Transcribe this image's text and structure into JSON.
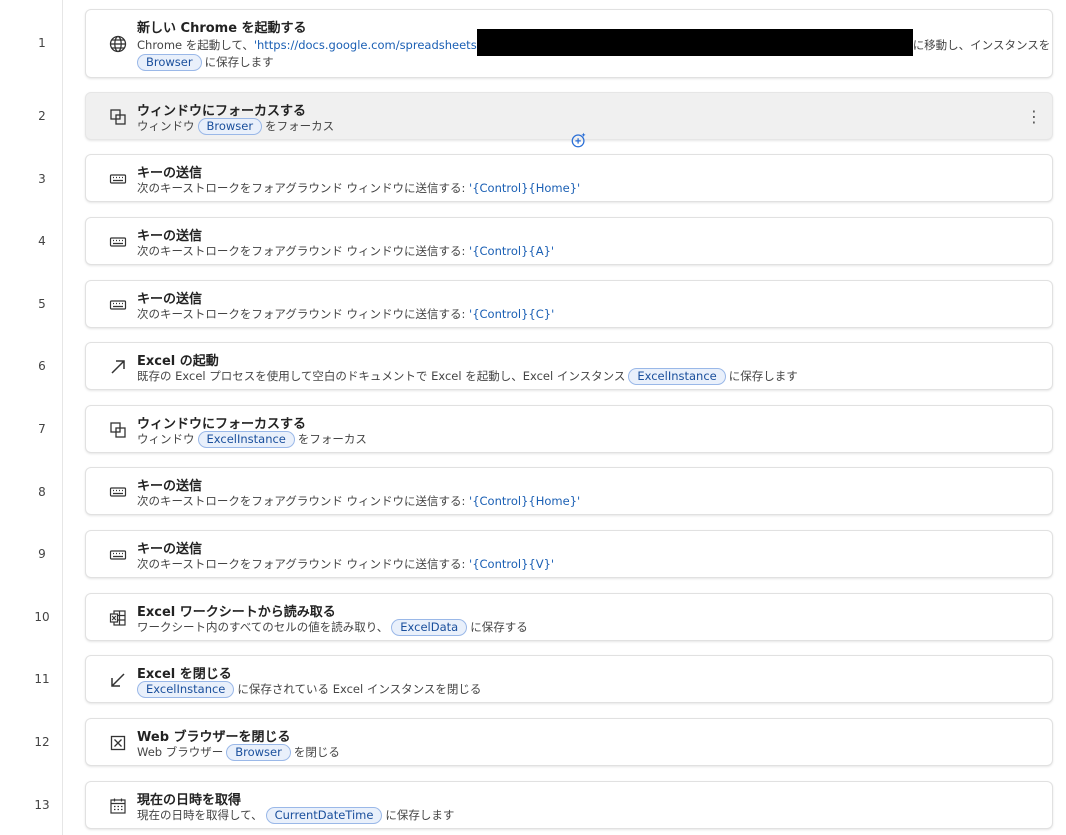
{
  "steps": [
    {
      "num": "1",
      "icon": "globe-icon",
      "title": "新しい Chrome を起動する",
      "desc_prefix": "Chrome を起動して、",
      "url": "'https://docs.google.com/spreadsheets",
      "desc_suffix": "に移動し、インスタンスを",
      "var": "Browser",
      "line2_suffix": "に保存します"
    },
    {
      "num": "2",
      "icon": "window-focus-icon",
      "title": "ウィンドウにフォーカスする",
      "desc_prefix": "ウィンドウ",
      "var": "Browser",
      "desc_suffix": "をフォーカス"
    },
    {
      "num": "3",
      "icon": "keyboard-icon",
      "title": "キーの送信",
      "desc_prefix": "次のキーストロークをフォアグラウンド ウィンドウに送信する: ",
      "value": "'{Control}{Home}'"
    },
    {
      "num": "4",
      "icon": "keyboard-icon",
      "title": "キーの送信",
      "desc_prefix": "次のキーストロークをフォアグラウンド ウィンドウに送信する: ",
      "value": "'{Control}{A}'"
    },
    {
      "num": "5",
      "icon": "keyboard-icon",
      "title": "キーの送信",
      "desc_prefix": "次のキーストロークをフォアグラウンド ウィンドウに送信する: ",
      "value": "'{Control}{C}'"
    },
    {
      "num": "6",
      "icon": "arrow-up-right-icon",
      "title": "Excel の起動",
      "desc_prefix": "既存の Excel プロセスを使用して空白のドキュメントで Excel を起動し、Excel インスタンス",
      "var": "ExcelInstance",
      "desc_suffix": "に保存します"
    },
    {
      "num": "7",
      "icon": "window-focus-icon",
      "title": "ウィンドウにフォーカスする",
      "desc_prefix": "ウィンドウ",
      "var": "ExcelInstance",
      "desc_suffix": "をフォーカス"
    },
    {
      "num": "8",
      "icon": "keyboard-icon",
      "title": "キーの送信",
      "desc_prefix": "次のキーストロークをフォアグラウンド ウィンドウに送信する: ",
      "value": "'{Control}{Home}'"
    },
    {
      "num": "9",
      "icon": "keyboard-icon",
      "title": "キーの送信",
      "desc_prefix": "次のキーストロークをフォアグラウンド ウィンドウに送信する: ",
      "value": "'{Control}{V}'"
    },
    {
      "num": "10",
      "icon": "excel-read-icon",
      "title": "Excel ワークシートから読み取る",
      "desc_prefix": "ワークシート内のすべてのセルの値を読み取り、",
      "var": "ExcelData",
      "desc_suffix": "に保存する"
    },
    {
      "num": "11",
      "icon": "arrow-down-left-icon",
      "title": "Excel を閉じる",
      "var": "ExcelInstance",
      "desc_suffix": "に保存されている Excel インスタンスを閉じる"
    },
    {
      "num": "12",
      "icon": "close-browser-icon",
      "title": "Web ブラウザーを閉じる",
      "desc_prefix": "Web ブラウザー",
      "var": "Browser",
      "desc_suffix": "を閉じる"
    },
    {
      "num": "13",
      "icon": "calendar-icon",
      "title": "現在の日時を取得",
      "desc_prefix": "現在の日時を取得して、",
      "var": "CurrentDateTime",
      "desc_suffix": "に保存します"
    }
  ],
  "more_glyph": "⋮"
}
